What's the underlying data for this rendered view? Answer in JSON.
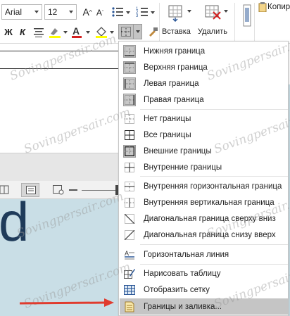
{
  "ribbon": {
    "font_name": "Arial",
    "font_size": "12",
    "bold": "Ж",
    "italic": "К",
    "insert_label": "Вставка",
    "delete_label": "Удалить",
    "copy_label": "Копир"
  },
  "menu": {
    "items": [
      {
        "label": "Нижняя граница",
        "icon": "border-bottom-icon"
      },
      {
        "label": "Верхняя граница",
        "icon": "border-top-icon"
      },
      {
        "label": "Левая граница",
        "icon": "border-left-icon"
      },
      {
        "label": "Правая граница",
        "icon": "border-right-icon"
      },
      {
        "label": "Нет границы",
        "icon": "border-none-icon"
      },
      {
        "label": "Все границы",
        "icon": "border-all-icon"
      },
      {
        "label": "Внешние границы",
        "icon": "border-outside-icon"
      },
      {
        "label": "Внутренние границы",
        "icon": "border-inside-icon"
      },
      {
        "label": "Внутренняя горизонтальная граница",
        "icon": "border-inside-horizontal-icon"
      },
      {
        "label": "Внутренняя вертикальная граница",
        "icon": "border-inside-vertical-icon"
      },
      {
        "label": "Диагональная граница сверху вниз",
        "icon": "border-diagonal-down-icon"
      },
      {
        "label": "Диагональная граница снизу вверх",
        "icon": "border-diagonal-up-icon"
      },
      {
        "label": "Горизонтальная линия",
        "icon": "horizontal-line-icon"
      },
      {
        "label": "Нарисовать таблицу",
        "icon": "draw-table-icon"
      },
      {
        "label": "Отобразить сетку",
        "icon": "view-gridlines-icon"
      },
      {
        "label": "Границы и заливка...",
        "icon": "borders-shading-icon"
      }
    ]
  },
  "document": {
    "visible_letter": "d"
  },
  "watermark": "Sovingpersair.com",
  "colors": {
    "menu_highlight": "#c5c5c5",
    "arrow": "#e03b2e",
    "doc_background": "#c9dee6",
    "font_color_red": "#d32020",
    "highlight_yellow": "#ffff00"
  }
}
